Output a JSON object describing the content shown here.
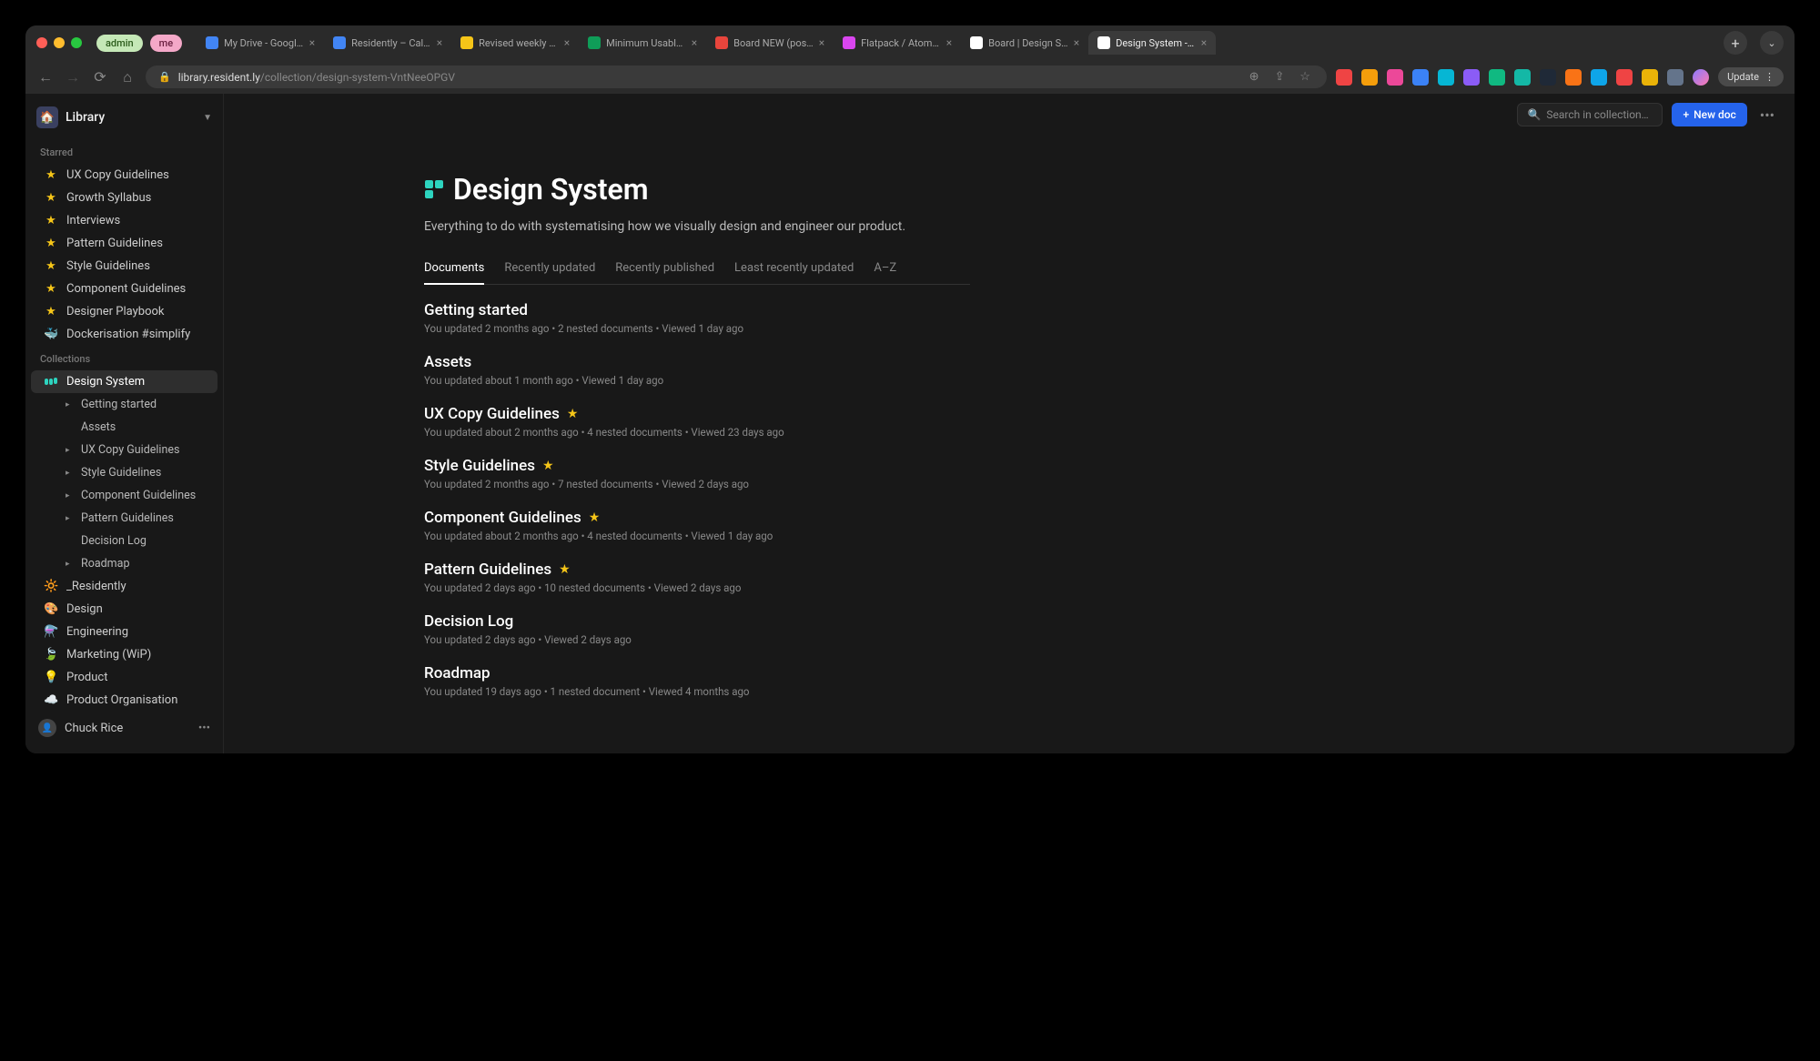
{
  "browser": {
    "pills": {
      "admin": "admin",
      "me": "me"
    },
    "tabs": [
      {
        "title": "My Drive - Google D",
        "favicon_color": "#4285f4"
      },
      {
        "title": "Residently – Calend",
        "favicon_color": "#4285f4"
      },
      {
        "title": "Revised weekly disc",
        "favicon_color": "#f5c518"
      },
      {
        "title": "Minimum Usable Jo",
        "favicon_color": "#0f9d58"
      },
      {
        "title": "Board NEW (post M",
        "favicon_color": "#e8453c"
      },
      {
        "title": "Flatpack / Atoms / S",
        "favicon_color": "#d946ef"
      },
      {
        "title": "Board | Design Syste",
        "favicon_color": "#ffffff"
      },
      {
        "title": "Design System - Lib",
        "favicon_color": "#ffffff",
        "active": true
      }
    ],
    "url_host": "library.resident.ly",
    "url_path": "/collection/design-system-VntNeeOPGV",
    "update_label": "Update"
  },
  "sidebar": {
    "library_label": "Library",
    "starred_label": "Starred",
    "starred": [
      "UX Copy Guidelines",
      "Growth Syllabus",
      "Interviews",
      "Pattern Guidelines",
      "Style Guidelines",
      "Component Guidelines",
      "Designer Playbook"
    ],
    "docker_label": "Dockerisation #simplify",
    "docker_emoji": "🐳",
    "collections_label": "Collections",
    "design_system_label": "Design System",
    "design_system_children": [
      {
        "label": "Getting started",
        "disc": true
      },
      {
        "label": "Assets",
        "disc": false
      },
      {
        "label": "UX Copy Guidelines",
        "disc": true
      },
      {
        "label": "Style Guidelines",
        "disc": true
      },
      {
        "label": "Component Guidelines",
        "disc": true
      },
      {
        "label": "Pattern Guidelines",
        "disc": true
      },
      {
        "label": "Decision Log",
        "disc": false
      },
      {
        "label": "Roadmap",
        "disc": true
      }
    ],
    "other_collections": [
      {
        "label": "_Residently",
        "icon": "🔆",
        "color": "#4ade80"
      },
      {
        "label": "Design",
        "icon": "🎨",
        "color": "#f472b6"
      },
      {
        "label": "Engineering",
        "icon": "⚗️",
        "color": "#93c5fd"
      },
      {
        "label": "Marketing (WiP)",
        "icon": "🍃",
        "color": "#60a5fa"
      },
      {
        "label": "Product",
        "icon": "💡",
        "color": "#c084fc"
      },
      {
        "label": "Product Organisation",
        "icon": "☁️",
        "color": "#fbbf24"
      }
    ],
    "user_name": "Chuck Rice"
  },
  "header": {
    "search_placeholder": "Search in collection…",
    "new_doc_label": "New doc"
  },
  "collection": {
    "title": "Design System",
    "description": "Everything to do with systematising how we visually design and engineer our product.",
    "filter_tabs": [
      "Documents",
      "Recently updated",
      "Recently published",
      "Least recently updated",
      "A–Z"
    ],
    "documents": [
      {
        "title": "Getting started",
        "starred": false,
        "meta": "You updated 2 months ago • 2 nested documents • Viewed 1 day ago"
      },
      {
        "title": "Assets",
        "starred": false,
        "meta": "You updated about 1 month ago • Viewed 1 day ago"
      },
      {
        "title": "UX Copy Guidelines",
        "starred": true,
        "meta": "You updated about 2 months ago • 4 nested documents • Viewed 23 days ago"
      },
      {
        "title": "Style Guidelines",
        "starred": true,
        "meta": "You updated 2 months ago • 7 nested documents • Viewed 2 days ago"
      },
      {
        "title": "Component Guidelines",
        "starred": true,
        "meta": "You updated about 2 months ago • 4 nested documents • Viewed 1 day ago"
      },
      {
        "title": "Pattern Guidelines",
        "starred": true,
        "meta": "You updated 2 days ago • 10 nested documents • Viewed 2 days ago"
      },
      {
        "title": "Decision Log",
        "starred": false,
        "meta": "You updated 2 days ago • Viewed 2 days ago"
      },
      {
        "title": "Roadmap",
        "starred": false,
        "meta": "You updated 19 days ago • 1 nested document • Viewed 4 months ago"
      }
    ]
  }
}
